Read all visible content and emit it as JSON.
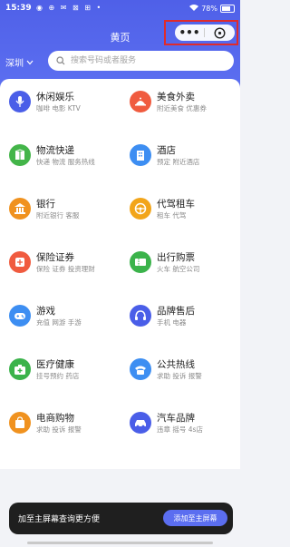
{
  "status": {
    "time": "15:39",
    "left_icons": "◉ ⊕ ✉ ⊠ ⊞ •",
    "battery": "78%",
    "battery_level": 0.78
  },
  "header": {
    "title": "黄页",
    "city": "深圳",
    "search_placeholder": "搜索号码或者服务"
  },
  "capsule": {
    "more_icon": "more-dots-icon",
    "close_icon": "close-target-icon"
  },
  "categories": [
    {
      "title": "休闲娱乐",
      "sub": "咖啡 电影 KTV",
      "icon": "microphone-icon",
      "color": "#4a5ee8"
    },
    {
      "title": "美食外卖",
      "sub": "附近美食 优惠券",
      "icon": "food-cloche-icon",
      "color": "#f05b3f"
    },
    {
      "title": "物流快递",
      "sub": "快递 物流 服务热线",
      "icon": "package-icon",
      "color": "#43b549"
    },
    {
      "title": "酒店",
      "sub": "预定 附近酒店",
      "icon": "building-icon",
      "color": "#3d8ef2"
    },
    {
      "title": "银行",
      "sub": "附近银行 客服",
      "icon": "bank-icon",
      "color": "#f0921f"
    },
    {
      "title": "代驾租车",
      "sub": "租车 代驾",
      "icon": "steering-wheel-icon",
      "color": "#f2a51a"
    },
    {
      "title": "保险证券",
      "sub": "保险 证券 投资理财",
      "icon": "insurance-icon",
      "color": "#f05b3f"
    },
    {
      "title": "出行购票",
      "sub": "火车 航空公司",
      "icon": "ticket-icon",
      "color": "#3bb34b"
    },
    {
      "title": "游戏",
      "sub": "充值 网游 手游",
      "icon": "gamepad-icon",
      "color": "#3d8ef2"
    },
    {
      "title": "品牌售后",
      "sub": "手机 电器",
      "icon": "headset-icon",
      "color": "#4a5ee8"
    },
    {
      "title": "医疗健康",
      "sub": "挂号预约 药店",
      "icon": "medical-kit-icon",
      "color": "#3bb34b"
    },
    {
      "title": "公共热线",
      "sub": "求助 投诉 报警",
      "icon": "telephone-icon",
      "color": "#3d8ef2"
    },
    {
      "title": "电商购物",
      "sub": "求助 投诉 报警",
      "icon": "shopping-bag-icon",
      "color": "#f0921f"
    },
    {
      "title": "汽车品牌",
      "sub": "违章 摇号 4s店",
      "icon": "car-icon",
      "color": "#4a5ee8"
    }
  ],
  "toast": {
    "text": "加至主屏幕查询更方便",
    "button": "添加至主屏幕"
  }
}
